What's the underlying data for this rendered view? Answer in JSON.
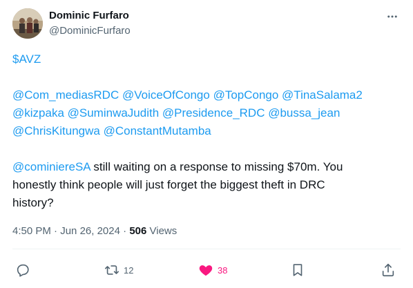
{
  "author": {
    "name": "Dominic Furfaro",
    "handle": "@DominicFurfaro"
  },
  "tweet": {
    "line1": "$AVZ",
    "mentions_line1": "@Com_mediasRDC @VoiceOfCongo @TopCongo @TinaSalama2",
    "mentions_line2": "@kizpaka @SuminwaJudith @Presidence_RDC @bussa_jean",
    "mentions_line3": "@ChrisKitungwa @ConstantMutamba",
    "reply_mention": "@cominiereSA",
    "text_line1": " still waiting on a response to missing $70m. You",
    "text_line2": "honestly think people will just forget the biggest theft in DRC",
    "text_line3": "history?"
  },
  "meta": {
    "time": "4:50 PM",
    "separator": " · ",
    "date": "Jun 26, 2024",
    "views_count": "506",
    "views_label": " Views"
  },
  "actions": {
    "retweets": "12",
    "likes": "38"
  },
  "colors": {
    "link": "#1d9bf0",
    "like": "#f91880",
    "secondary": "#536471"
  }
}
